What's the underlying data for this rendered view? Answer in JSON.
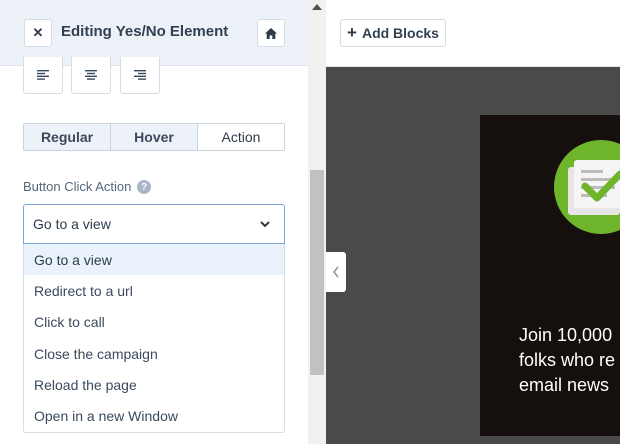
{
  "panel": {
    "title": "Editing Yes/No Element",
    "close_icon": "close-icon",
    "home_icon": "home-icon",
    "align_buttons": [
      "align-left-icon",
      "align-center-icon",
      "align-right-icon"
    ]
  },
  "tabs": [
    {
      "label": "Regular",
      "active": false
    },
    {
      "label": "Hover",
      "active": false
    },
    {
      "label": "Action",
      "active": true
    }
  ],
  "button_click_action": {
    "label": "Button Click Action",
    "help_icon": "?",
    "selected": "Go to a view",
    "options": [
      "Go to a view",
      "Redirect to a url",
      "Click to call",
      "Close the campaign",
      "Reload the page",
      "Open in a new Window"
    ]
  },
  "toolbar": {
    "add_blocks_icon": "+",
    "add_blocks_label": "Add Blocks"
  },
  "preview": {
    "text_lines": [
      "Join 10,000",
      "folks who re",
      "email news"
    ]
  },
  "colors": {
    "accent_green": "#6fb52c",
    "panel_header": "#edf2f8",
    "canvas_bg": "#4a4a4a",
    "preview_bg": "#150f0d",
    "selected_option_bg": "#eaf3fb"
  }
}
